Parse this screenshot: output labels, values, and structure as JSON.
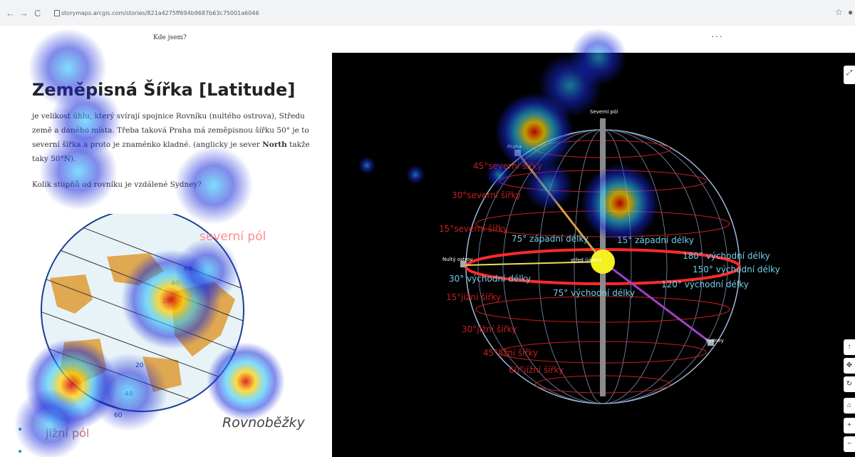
{
  "browser": {
    "back_icon": "arrow-left-icon",
    "forward_icon": "arrow-right-icon",
    "reload_icon": "reload-icon",
    "url": "storymaps.arcgis.com/stories/821a4275ff694b9687b63c75001a6046",
    "star_icon": "star-icon"
  },
  "topbar": {
    "where_label": "Kde jsem?",
    "more_label": "···"
  },
  "story": {
    "title": "Zeměpisná Šířka [Latitude]",
    "p1a": "je velikost úhlu, který svírají spojnice Rovníku (nultého ostrova), Středu země a daného místa. Třeba taková Praha má zeměpisnou šířku 50° je to severní šířka a proto je znaménko kladné. (anglicky je sever ",
    "p1b": "North",
    "p1c": " takže taky 50°N).",
    "question": "Kolik stupňů od rovníku je vzdálené Sydney?",
    "globe_north": "severní pól",
    "globe_south": "jižní pól",
    "globe_parallels": "Rovnoběžky",
    "globe_deg": [
      "60",
      "40",
      "20",
      "20",
      "40",
      "60"
    ]
  },
  "scene": {
    "north_pole": "Severní pól",
    "praha": "Praha",
    "nulty": "Nultý ostrov",
    "center": "střed (jádro)",
    "sydney": "Sydney",
    "lat_labels": [
      "45°severní šířky",
      "30°severní šířky",
      "15°severní šířky",
      "15°jižní šířky",
      "30°jižní šířky",
      "45°jižní šířky",
      "60°jižní šířky"
    ],
    "lon_labels": [
      "75° západní délky",
      "15° západní délky",
      "180° východní délky",
      "150° východní délky",
      "120° východní délky",
      "30° východní délky",
      "75° východní délky"
    ],
    "tools": [
      "compass-icon",
      "pan-icon",
      "rotate-icon",
      "home-icon",
      "zoom-in-icon"
    ],
    "expand_icon": "expand-icon"
  }
}
